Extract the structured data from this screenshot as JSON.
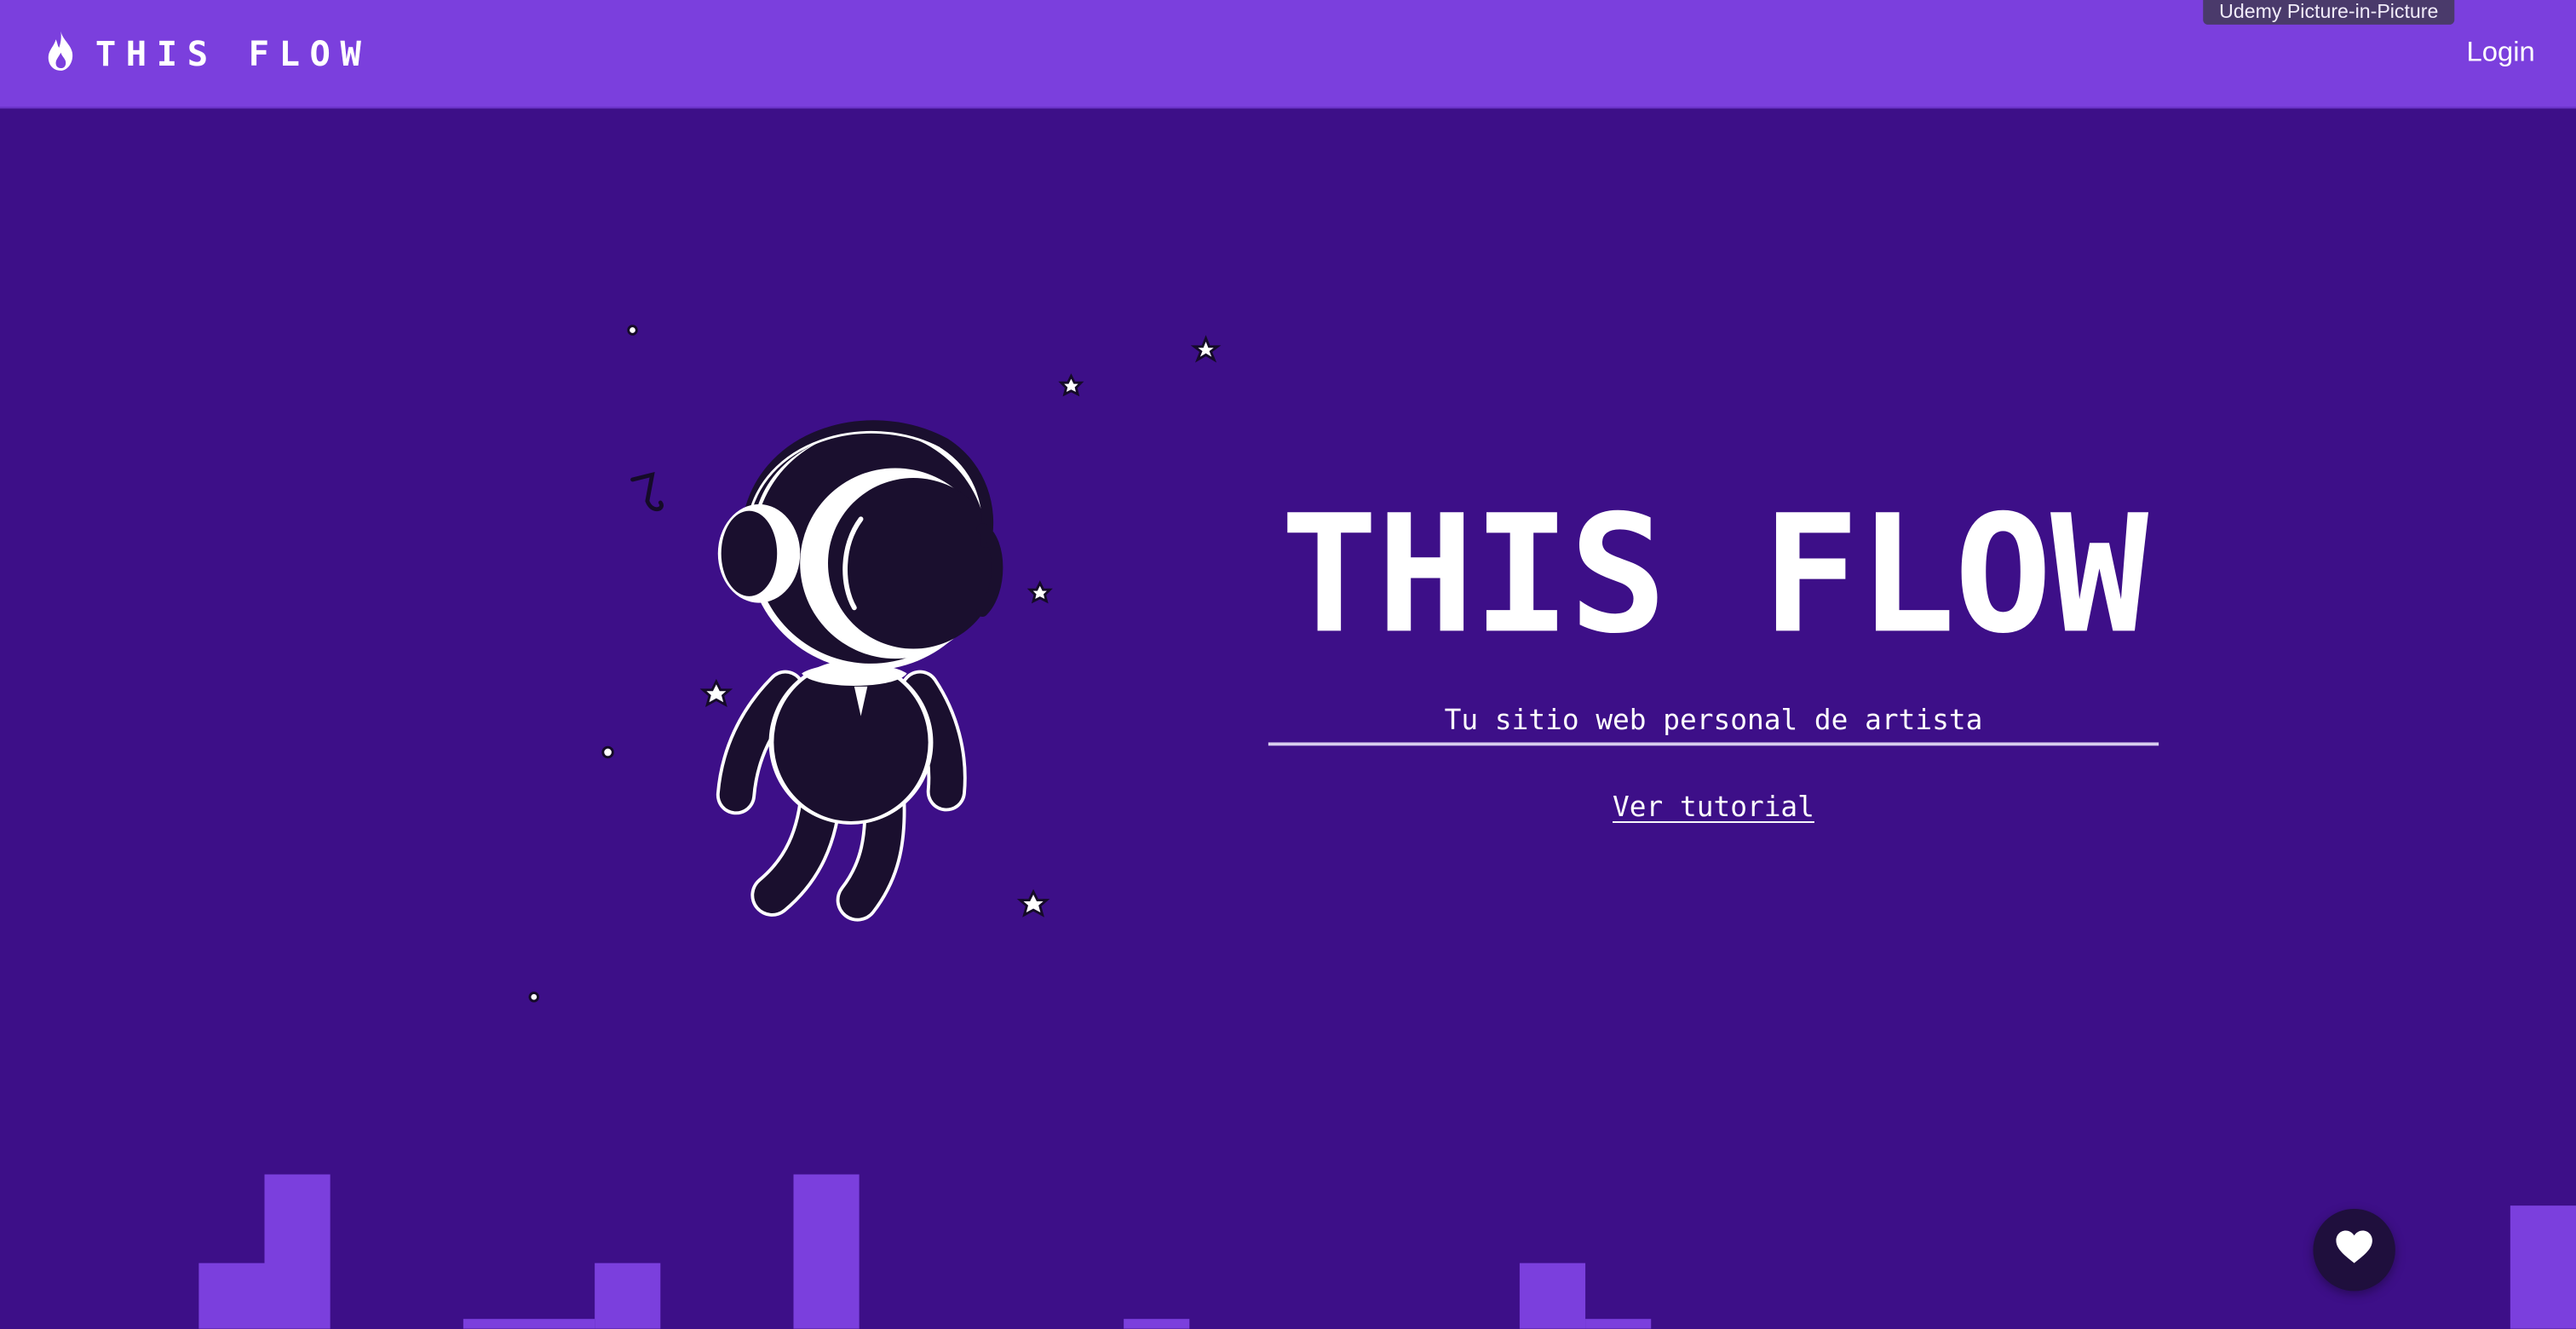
{
  "topbar": {
    "brand_label": "THIS FLOW",
    "brand_icon": "flame-icon",
    "login_label": "Login",
    "background": "#7b3fdd"
  },
  "overlay": {
    "pip_tooltip": "Udemy Picture-in-Picture"
  },
  "hero": {
    "title": "THIS FLOW",
    "subtitle": "Tu sitio web personal de artista",
    "tutorial_label": "Ver tutorial",
    "illustration": "astronaut-with-headphones-icon",
    "background": "#3d0f88"
  },
  "floating_button": {
    "icon": "heart-icon"
  },
  "colors": {
    "accent": "#7b3fdd",
    "background": "#3d0f88",
    "dark": "#1a0f2e",
    "text": "#ffffff"
  }
}
